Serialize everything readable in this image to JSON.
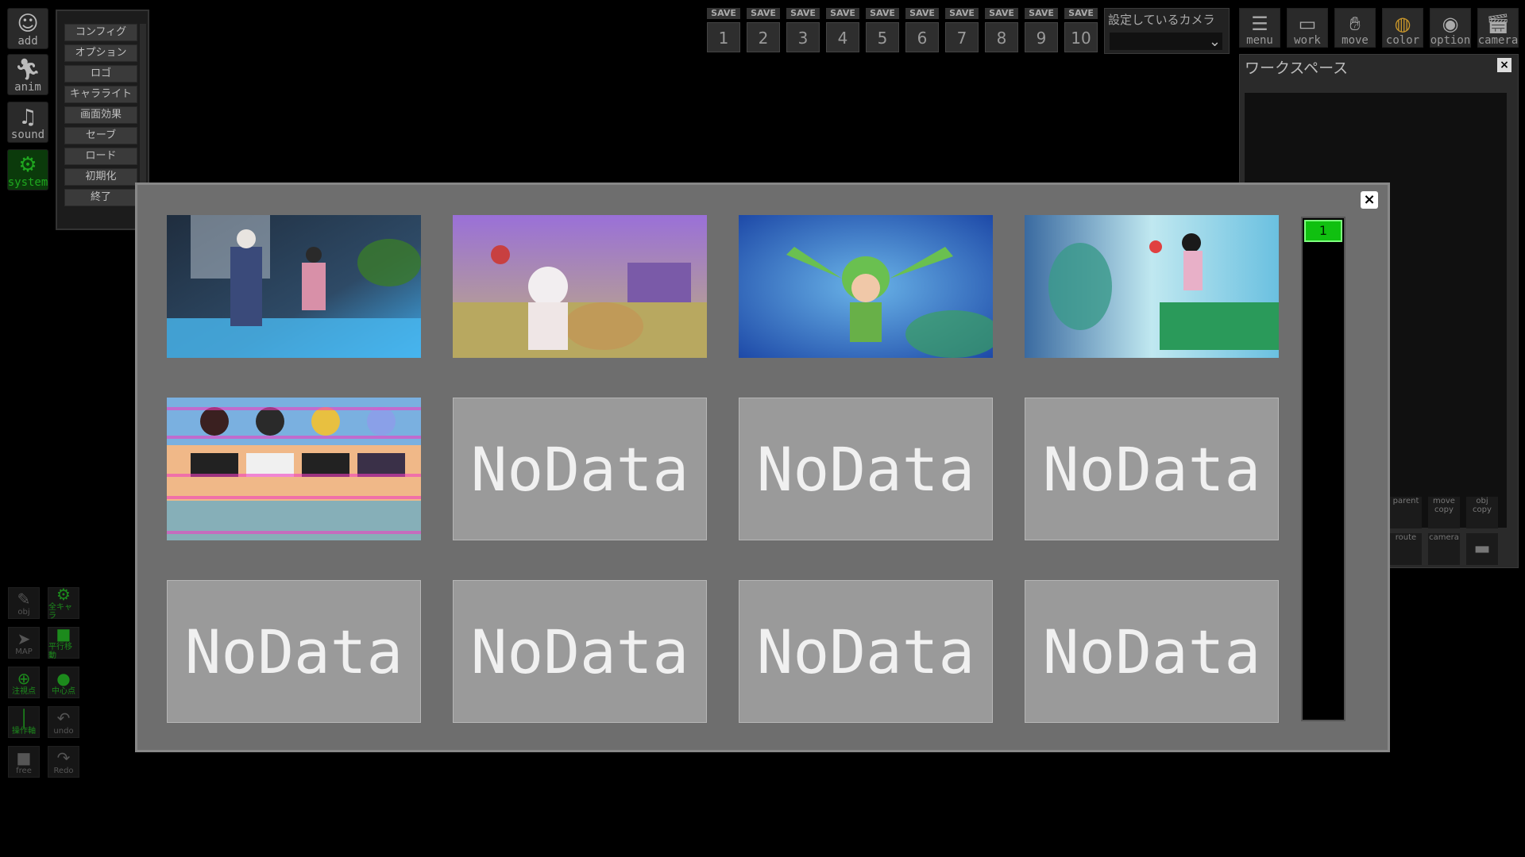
{
  "left_tools": [
    {
      "label": "add",
      "icon": "person-add-icon"
    },
    {
      "label": "anim",
      "icon": "running-figure-icon"
    },
    {
      "label": "sound",
      "icon": "music-note-icon"
    },
    {
      "label": "system",
      "icon": "gears-icon",
      "active": true
    }
  ],
  "system_menu": [
    "コンフィグ",
    "オプション",
    "ロゴ",
    "キャラライト",
    "画面効果",
    "セーブ",
    "ロード",
    "初期化",
    "終了"
  ],
  "save_slots": {
    "tag": "SAVE",
    "numbers": [
      "1",
      "2",
      "3",
      "4",
      "5",
      "6",
      "7",
      "8",
      "9",
      "10"
    ]
  },
  "camera_select": {
    "label": "設定しているカメラ",
    "value": ""
  },
  "top_tools": [
    {
      "label": "menu",
      "icon": "menu-list-icon"
    },
    {
      "label": "work",
      "icon": "window-frame-icon"
    },
    {
      "label": "move",
      "icon": "hand-icon"
    },
    {
      "label": "color",
      "icon": "palette-icon"
    },
    {
      "label": "option",
      "icon": "eye-icon"
    },
    {
      "label": "camera",
      "icon": "clapper-icon"
    }
  ],
  "workspace": {
    "title": "ワークスペース",
    "icons": [
      {
        "label": "parent",
        "icon": "parent-icon"
      },
      {
        "label": "move copy",
        "icon": "move-copy-icon"
      },
      {
        "label": "obj copy",
        "icon": "obj-copy-icon"
      },
      {
        "label": "route",
        "icon": "route-icon"
      },
      {
        "label": "camera",
        "icon": "camera-icon"
      },
      {
        "label": "",
        "icon": "folder-icon"
      }
    ]
  },
  "bottom_tools": [
    {
      "label": "obj",
      "icon": "edit-icon",
      "green": false
    },
    {
      "label": "全キャラ",
      "icon": "gear-icon",
      "green": true
    },
    {
      "label": "MAP",
      "icon": "pin-icon",
      "green": false
    },
    {
      "label": "平行移動",
      "icon": "square-icon",
      "green": true
    },
    {
      "label": "注視点",
      "icon": "plus-circle-icon",
      "green": true
    },
    {
      "label": "中心点",
      "icon": "dot-circle-icon",
      "green": true
    },
    {
      "label": "操作軸",
      "icon": "axis-icon",
      "green": true
    },
    {
      "label": "undo",
      "icon": "undo-icon",
      "green": false
    },
    {
      "label": "free",
      "icon": "video-camera-icon",
      "green": false
    },
    {
      "label": "Redo",
      "icon": "redo-icon",
      "green": false
    }
  ],
  "load_dialog": {
    "close_label": "×",
    "page_label": "1",
    "empty_label": "NoData",
    "slots": [
      {
        "type": "thumbnail",
        "scene": "shrine-veranda-guitar"
      },
      {
        "type": "thumbnail",
        "scene": "bath-tub-purple"
      },
      {
        "type": "thumbnail",
        "scene": "frog-costume-blue"
      },
      {
        "type": "thumbnail",
        "scene": "ping-pong-room"
      },
      {
        "type": "thumbnail",
        "scene": "four-girls-bikini"
      },
      {
        "type": "empty"
      },
      {
        "type": "empty"
      },
      {
        "type": "empty"
      },
      {
        "type": "empty"
      },
      {
        "type": "empty"
      },
      {
        "type": "empty"
      },
      {
        "type": "empty"
      }
    ]
  }
}
